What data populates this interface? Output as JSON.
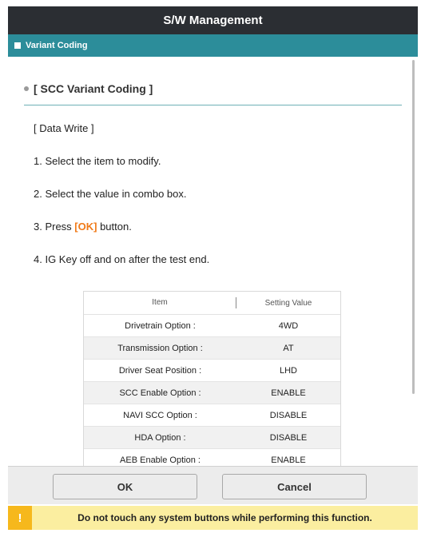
{
  "window": {
    "title": "S/W Management"
  },
  "subheader": {
    "label": "Variant Coding"
  },
  "section": {
    "title": "[ SCC Variant Coding ]"
  },
  "instructions": {
    "heading": "[ Data Write ]",
    "step1": "1. Select the item to modify.",
    "step2": "2. Select the value in combo box.",
    "step3_prefix": "3. Press ",
    "step3_ok": "[OK]",
    "step3_suffix": " button.",
    "step4": "4. IG Key off and on after the test end."
  },
  "table": {
    "col_item": "Item",
    "col_value": "Setting Value",
    "rows": [
      {
        "item": "Drivetrain Option :",
        "value": "4WD"
      },
      {
        "item": "Transmission Option :",
        "value": "AT"
      },
      {
        "item": "Driver Seat Position :",
        "value": "LHD"
      },
      {
        "item": "SCC Enable Option :",
        "value": "ENABLE"
      },
      {
        "item": "NAVI SCC Option :",
        "value": "DISABLE"
      },
      {
        "item": "HDA Option :",
        "value": "DISABLE"
      },
      {
        "item": "AEB Enable Option :",
        "value": "ENABLE"
      }
    ]
  },
  "buttons": {
    "ok": "OK",
    "cancel": "Cancel"
  },
  "warning": {
    "icon": "!",
    "message": "Do not touch any system buttons while performing this function."
  },
  "colors": {
    "titlebar": "#2b2e33",
    "subheader": "#2c8d9a",
    "accent": "#f07a18",
    "warning_bg": "#fbeea0",
    "warning_icon": "#f6b81c"
  }
}
